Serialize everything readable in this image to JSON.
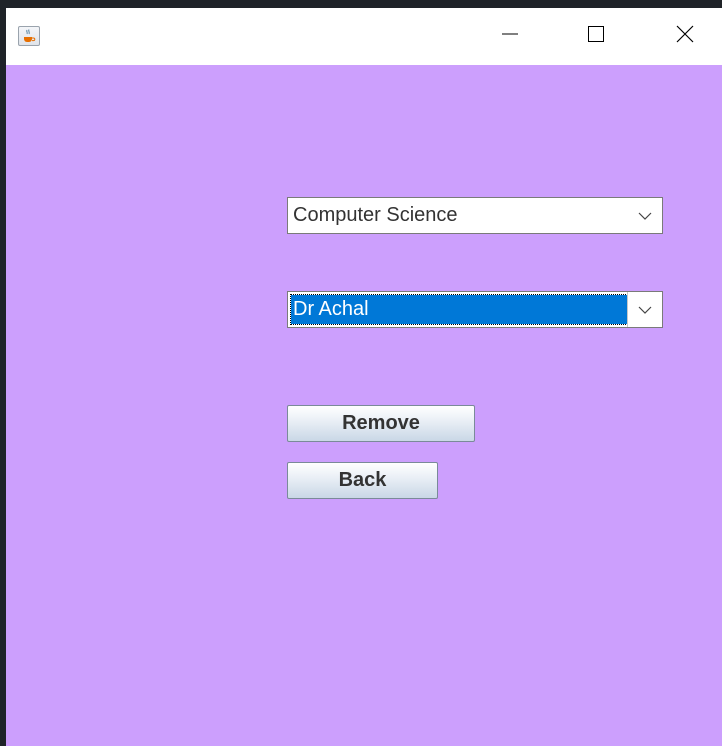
{
  "window": {
    "icon": "java-cup-icon",
    "controls": [
      "minimize-icon",
      "maximize-icon",
      "close-icon"
    ]
  },
  "form": {
    "department_select": {
      "value": "Computer Science",
      "icon": "chevron-down-icon"
    },
    "faculty_select": {
      "value": "Dr Achal",
      "icon": "chevron-down-icon",
      "selected_color": "#0078d7"
    },
    "remove_label": "Remove",
    "back_label": "Back"
  },
  "colors": {
    "background": "#cc9ffd",
    "titlebar": "#ffffff",
    "outer": "#1f2328"
  }
}
